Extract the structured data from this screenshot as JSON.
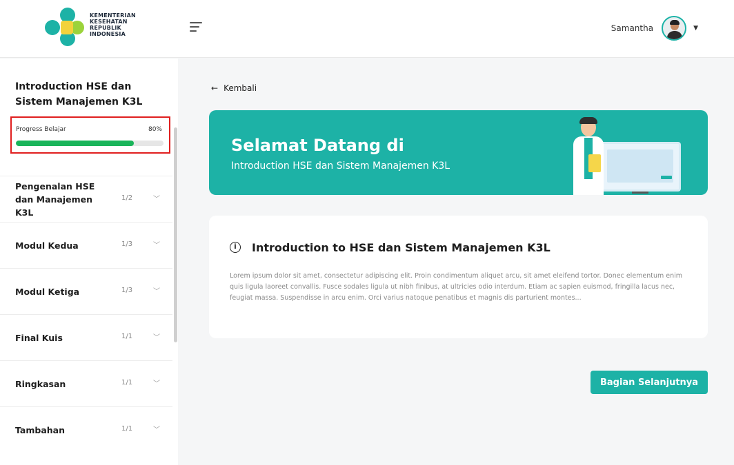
{
  "header": {
    "logo_lines": [
      "KEMENTERIAN",
      "KESEHATAN",
      "REPUBLIK",
      "INDONESIA"
    ],
    "menu_icon": "hamburger-icon",
    "user_name": "Samantha",
    "dropdown_icon": "caret-down-icon"
  },
  "sidebar": {
    "course_title": "Introduction  HSE dan Sistem Manajemen K3L",
    "progress": {
      "label": "Progress Belajar",
      "percent_text": "80%",
      "value": 0.8
    },
    "modules": [
      {
        "name": "Pengenalan HSE dan Manajemen K3L",
        "count": "1/2"
      },
      {
        "name": "Modul Kedua",
        "count": "1/3"
      },
      {
        "name": "Modul Ketiga",
        "count": "1/3"
      },
      {
        "name": "Final Kuis",
        "count": "1/1"
      },
      {
        "name": "Ringkasan",
        "count": "1/1"
      },
      {
        "name": "Tambahan",
        "count": "1/1"
      }
    ]
  },
  "main": {
    "back_label": "Kembali",
    "banner": {
      "title": "Selamat Datang di",
      "subtitle": "Introduction HSE dan Sistem Manajemen K3L"
    },
    "info": {
      "title": "Introduction to HSE dan Sistem Manajemen K3L",
      "body": "Lorem ipsum dolor sit amet, consectetur adipiscing elit. Proin condimentum aliquet arcu, sit amet eleifend tortor. Donec elementum enim quis ligula laoreet convallis. Fusce sodales ligula ut nibh finibus, at ultricies odio interdum. Etiam ac sapien euismod, fringilla lacus nec, feugiat massa. Suspendisse in arcu enim. Orci varius natoque penatibus et magnis dis parturient montes..."
    },
    "next_button": "Bagian Selanjutnya"
  },
  "colors": {
    "primary": "#1db2a6",
    "progress": "#1ab45a",
    "highlight_border": "#e01e1e"
  }
}
